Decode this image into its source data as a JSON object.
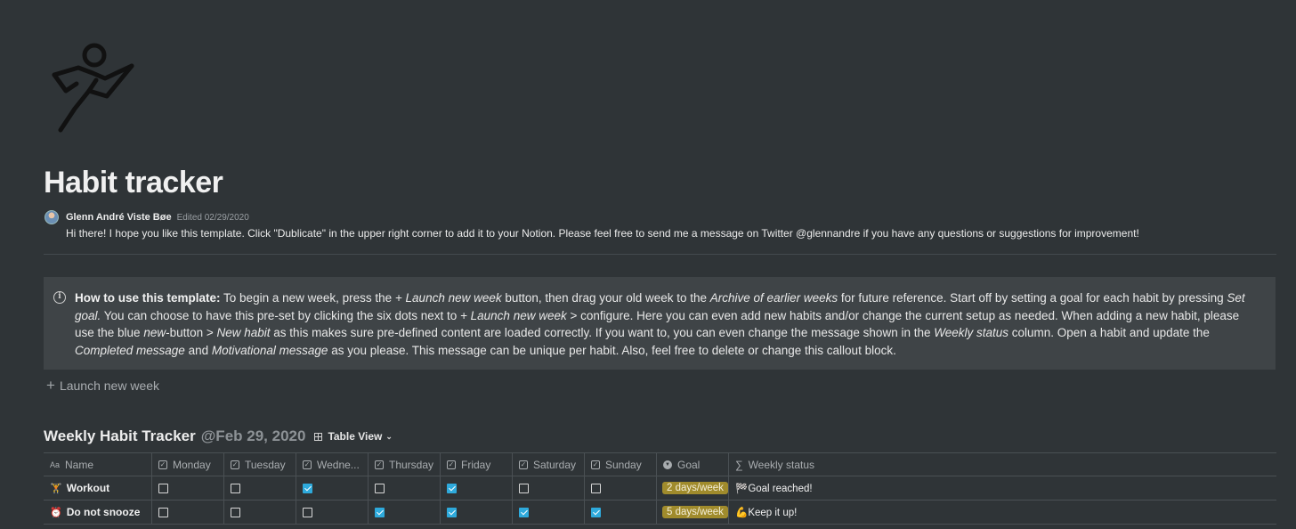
{
  "page": {
    "title": "Habit tracker",
    "icon": "kick-person-icon",
    "author": "Glenn André Viste Bøe",
    "edited": "Edited 02/29/2020",
    "intro": "Hi there! I hope you like this template. Click \"Dublicate\" in the upper right corner to add it to your Notion. Please feel free to send me a message on Twitter @glennandre if you have any questions or suggestions for improvement!"
  },
  "callout": {
    "icon": "info-icon",
    "bold": "How to use this template:",
    "t1": " To begin a new week, press the ",
    "i1": "+ Launch new week",
    "t2": " button, then drag your old week to the ",
    "i2": "Archive of earlier weeks",
    "t3": " for future reference. Start off by setting a goal for each habit by pressing ",
    "i3": "Set goal.",
    "t4": " You can choose to have this pre-set by clicking the six dots next to ",
    "i4": "+ Launch new week",
    "t5": " > configure. Here you can even add new habits and/or change the current setup as needed. When adding a new habit, please use the blue ",
    "i5": "new",
    "t6": "-button > ",
    "i6": "New habit",
    "t7": " as this makes sure pre-defined content are loaded correctly. If you want to, you can even change the message shown in the ",
    "i7": "Weekly status",
    "t8": " column. Open a habit and update the ",
    "i8": "Completed message",
    "t9": " and ",
    "i9": "Motivational message",
    "t10": " as you please. This message can be unique per habit. Also, feel free to delete or change this callout block."
  },
  "launch_button": {
    "label": "Launch new week"
  },
  "database": {
    "title": "Weekly Habit Tracker",
    "date": "@Feb 29, 2020",
    "view": "Table View",
    "columns": [
      "Name",
      "Monday",
      "Tuesday",
      "Wedne...",
      "Thursday",
      "Friday",
      "Saturday",
      "Sunday",
      "Goal",
      "Weekly status"
    ],
    "rows": [
      {
        "emoji": "🏋️",
        "name": "Workout",
        "days": [
          false,
          false,
          true,
          false,
          true,
          false,
          false
        ],
        "goal": "2 days/week",
        "status": "🏁Goal reached!"
      },
      {
        "emoji": "⏰",
        "name": "Do not snooze",
        "days": [
          false,
          false,
          false,
          true,
          true,
          true,
          true
        ],
        "goal": "5 days/week",
        "status": "💪Keep it up!"
      }
    ]
  }
}
